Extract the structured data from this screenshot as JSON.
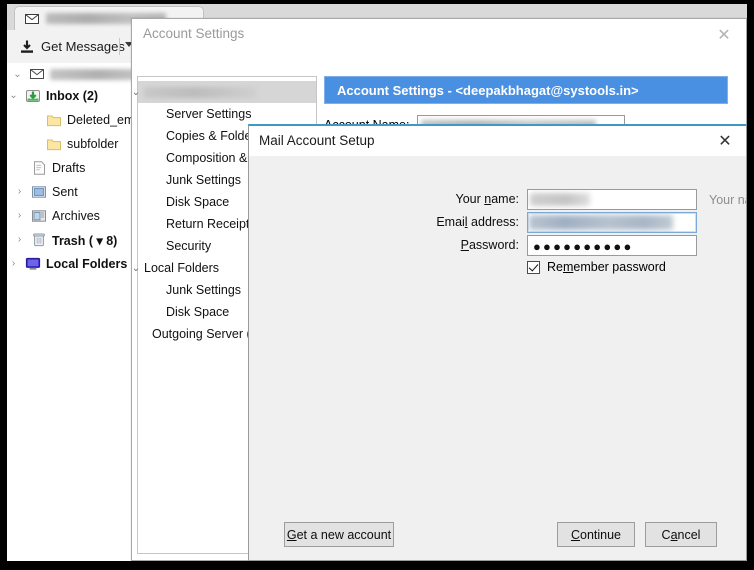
{
  "colors": {
    "accent_blue": "#4a90e2",
    "dialog_top_border": "#3e9ac4",
    "window_chrome": "#f0f0f0",
    "helper_text": "#8d8d8d",
    "selected_tree_row": "#d6d6d6"
  },
  "thunderbird": {
    "tab": {
      "name": "mail-tab",
      "icon": "envelope-icon",
      "label": ""
    },
    "toolbar": {
      "get_messages_label": "Get Messages",
      "get_messages_icon": "download-icon",
      "dropdown_icon": "chevron-down-icon"
    },
    "folder_pane": {
      "account_row": {
        "icon": "envelope-icon",
        "label": "",
        "twisty": "⌄"
      },
      "folders": [
        {
          "twisty": "⌄",
          "icon": "inbox-icon",
          "label": "Inbox (2)",
          "bold": true,
          "indent": 14
        },
        {
          "twisty": "",
          "icon": "folder-icon",
          "label": "Deleted_emails",
          "bold": false,
          "indent": 35
        },
        {
          "twisty": "",
          "icon": "folder-icon",
          "label": "subfolder",
          "bold": false,
          "indent": 35
        },
        {
          "twisty": "",
          "icon": "drafts-icon",
          "label": "Drafts",
          "bold": false,
          "indent": 20
        },
        {
          "twisty": "›",
          "icon": "sent-icon",
          "label": "Sent",
          "bold": false,
          "indent": 20
        },
        {
          "twisty": "›",
          "icon": "archives-icon",
          "label": "Archives",
          "bold": false,
          "indent": 20
        },
        {
          "twisty": "›",
          "icon": "trash-icon",
          "label": "Trash ( ▾ 8)",
          "bold": true,
          "indent": 20
        },
        {
          "twisty": "›",
          "icon": "local-folders-icon",
          "label": "Local Folders",
          "bold": true,
          "indent": 14
        }
      ]
    }
  },
  "account_settings_window": {
    "title": "Account Settings",
    "close_icon": "close-icon",
    "tree": [
      {
        "twisty": "⌄",
        "label": "",
        "indent": 6,
        "selected": true,
        "redacted": true
      },
      {
        "twisty": "",
        "label": "Server Settings",
        "indent": 28,
        "selected": false,
        "redacted": false
      },
      {
        "twisty": "",
        "label": "Copies & Folders",
        "indent": 28,
        "selected": false,
        "redacted": false
      },
      {
        "twisty": "",
        "label": "Composition & Addressing",
        "indent": 28,
        "selected": false,
        "redacted": false
      },
      {
        "twisty": "",
        "label": "Junk Settings",
        "indent": 28,
        "selected": false,
        "redacted": false
      },
      {
        "twisty": "",
        "label": "Disk Space",
        "indent": 28,
        "selected": false,
        "redacted": false
      },
      {
        "twisty": "",
        "label": "Return Receipts",
        "indent": 28,
        "selected": false,
        "redacted": false
      },
      {
        "twisty": "",
        "label": "Security",
        "indent": 28,
        "selected": false,
        "redacted": false
      },
      {
        "twisty": "⌄",
        "label": "Local Folders",
        "indent": 6,
        "selected": false,
        "redacted": false
      },
      {
        "twisty": "",
        "label": "Junk Settings",
        "indent": 28,
        "selected": false,
        "redacted": false
      },
      {
        "twisty": "",
        "label": "Disk Space",
        "indent": 28,
        "selected": false,
        "redacted": false
      },
      {
        "twisty": "",
        "label": "Outgoing Server (SMTP)",
        "indent": 14,
        "selected": false,
        "redacted": false
      }
    ],
    "pane": {
      "header": "Account Settings - <deepakbhagat@systools.in>",
      "account_name_label": "Account Name:",
      "account_name_label_accel": "N",
      "account_name_value": ""
    }
  },
  "mail_account_setup": {
    "title": "Mail Account Setup",
    "close_icon": "close-icon",
    "fields": {
      "your_name": {
        "label": "Your name:",
        "accel": "n",
        "value": "",
        "helper": "Your name, as shown to others",
        "focused": false
      },
      "email_address": {
        "label": "Email address:",
        "accel": "l",
        "value": "",
        "helper": "",
        "focused": true
      },
      "password": {
        "label": "Password:",
        "accel": "P",
        "value": "●●●●●●●●●●",
        "helper": "",
        "focused": false
      }
    },
    "remember_password": {
      "label": "Remember password",
      "accel": "m",
      "checked": true
    },
    "buttons": {
      "get_new_account": {
        "label": "Get a new account",
        "accel": "G"
      },
      "continue": {
        "label": "Continue",
        "accel": "C"
      },
      "cancel": {
        "label": "Cancel",
        "accel": "a"
      }
    }
  }
}
